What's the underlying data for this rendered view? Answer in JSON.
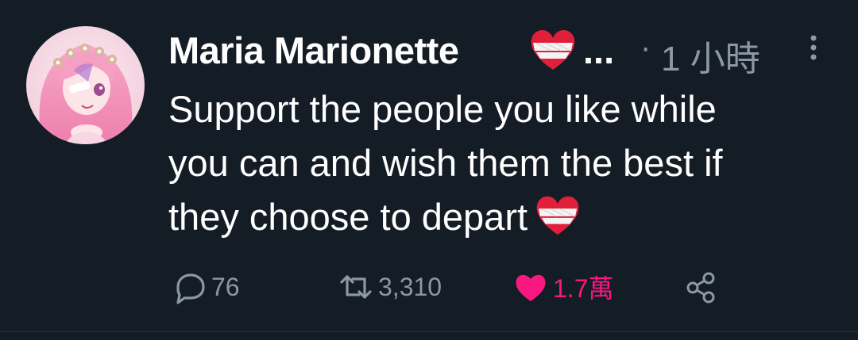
{
  "author": {
    "display_name": "Maria Marionette",
    "truncation": "...",
    "name_emoji": "bandaged-heart-icon"
  },
  "meta": {
    "separator": "·",
    "timestamp": "1 小時"
  },
  "tweet": {
    "lines": [
      "Support the people you like while",
      "you can and wish them the best if",
      "they choose to depart"
    ],
    "trailing_emoji": "bandaged-heart-icon"
  },
  "actions": {
    "replies": "76",
    "retweets": "3,310",
    "likes": "1.7萬"
  },
  "colors": {
    "background": "#15202b",
    "secondary_text": "#8b98a5",
    "like_pink": "#f91880",
    "heart_red": "#e0203a"
  }
}
